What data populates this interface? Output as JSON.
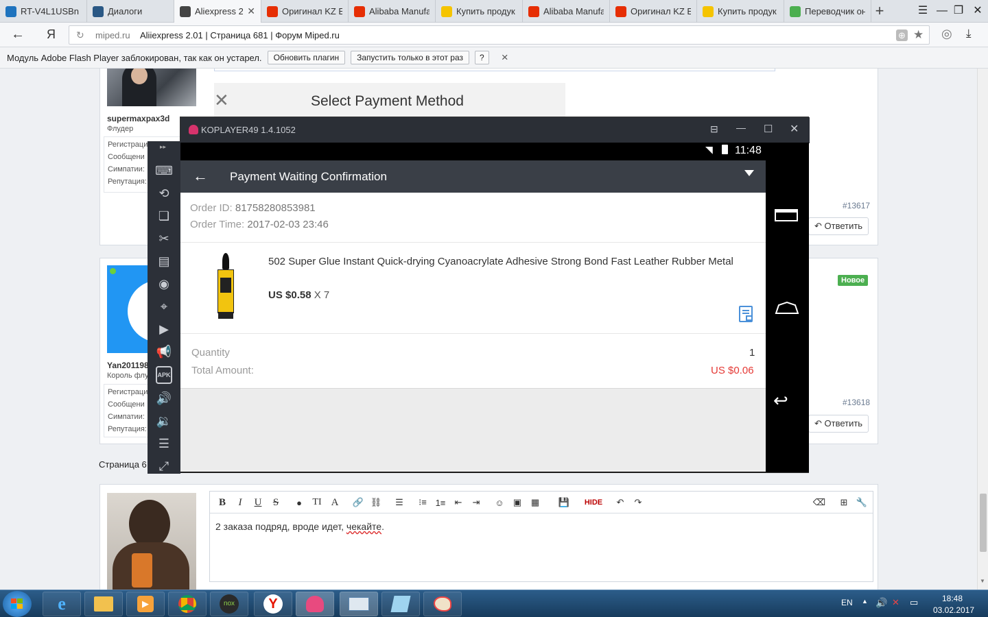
{
  "browser": {
    "tabs": [
      {
        "title": "RT-V4L1USBn",
        "icon_color": "#1e73be",
        "icon": "rt-icon",
        "active": false
      },
      {
        "title": "Диалоги",
        "icon_color": "#2a5885",
        "icon": "play-icon",
        "active": false
      },
      {
        "title": "Aliexpress 2.",
        "icon_color": "#444",
        "icon": "scooter-icon",
        "active": true
      },
      {
        "title": "Оригинал KZ E",
        "icon_color": "#e62e04",
        "icon": "aliexpress-icon",
        "active": false
      },
      {
        "title": "Alibaba Manufa",
        "icon_color": "#e62e04",
        "icon": "aliexpress-icon",
        "active": false
      },
      {
        "title": "Купить продук",
        "icon_color": "#f5c400",
        "icon": "cart-icon",
        "active": false
      },
      {
        "title": "Alibaba Manufa",
        "icon_color": "#e62e04",
        "icon": "aliexpress-icon",
        "active": false
      },
      {
        "title": "Оригинал KZ E",
        "icon_color": "#e62e04",
        "icon": "aliexpress-icon",
        "active": false
      },
      {
        "title": "Купить продук",
        "icon_color": "#f5c400",
        "icon": "cart-icon",
        "active": false
      },
      {
        "title": "Переводчик он",
        "icon_color": "#4caf50",
        "icon": "translate-icon",
        "active": false
      }
    ],
    "address_domain": "miped.ru",
    "address_title": "Aliiexpress 2.01 | Страница 681 | Форум Miped.ru",
    "yandex_glyph": "Я",
    "flash": {
      "message": "Модуль Adobe Flash Player заблокирован, так как он устарел.",
      "update_label": "Обновить плагин",
      "run_once_label": "Запустить только в этот раз",
      "help_label": "?",
      "close_label": "×"
    }
  },
  "forum": {
    "select_payment_title": "Select Payment Method",
    "user1": {
      "name": "supermaxpax3d",
      "title": "Флудер",
      "stats": [
        "Регистраци",
        "Сообщени",
        "Симпатии:",
        "Репутация:"
      ],
      "post_number": "#13617",
      "reply_label": "Ответить"
    },
    "user2": {
      "name": "Yan201198",
      "title": "Король флу",
      "stats": [
        "Регистраци",
        "Сообщени",
        "Симпатии:",
        "Репутация:"
      ],
      "post_number": "#13618",
      "reply_label": "Ответить",
      "new_badge": "Новое"
    },
    "page_label": "Страница 6",
    "editor_text_before": "2 заказа подряд, вроде идет, ",
    "editor_text_underlined": "чекайте",
    "editor_text_after": ".",
    "hide_label": "HIDE"
  },
  "emulator": {
    "title": "KOPLAYER49 1.4.1052",
    "status_time": "11:48",
    "appbar_title": "Payment Waiting Confirmation",
    "order_id_label": "Order ID:",
    "order_id_value": "81758280853981",
    "order_time_label": "Order Time:",
    "order_time_value": "2017-02-03 23:46",
    "product_title": "502 Super Glue Instant Quick-drying Cyanoacrylate Adhesive Strong Bond Fast Leather Rubber Metal",
    "product_price": "US $0.58",
    "product_qty": "X 7",
    "quantity_label": "Quantity",
    "quantity_value": "1",
    "total_label": "Total Amount:",
    "total_value": "US $0.06",
    "accent_color": "#e53935",
    "apk_label": "APK"
  },
  "taskbar": {
    "lang": "EN",
    "time": "18:48",
    "date": "03.02.2017"
  }
}
